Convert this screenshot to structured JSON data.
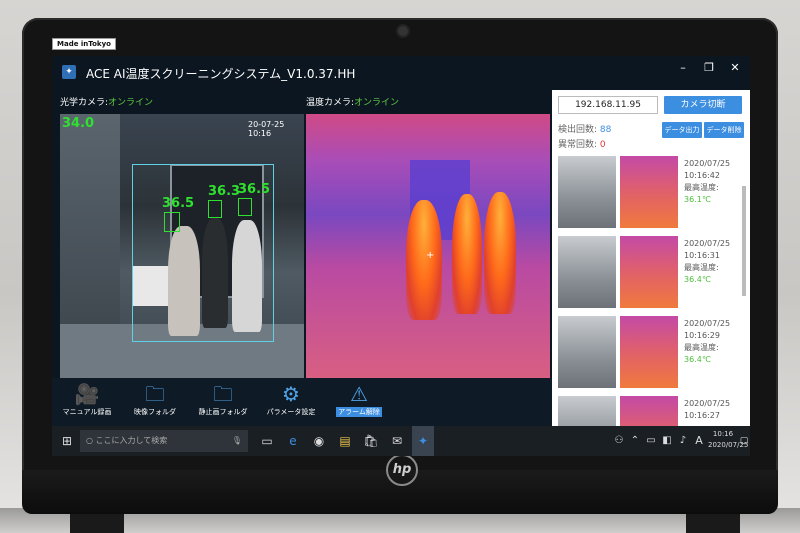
{
  "device": {
    "label": "Made inTokyo",
    "brand": "hp"
  },
  "app": {
    "title": "ACE AI温度スクリーニングシステム_V1.0.37.HH"
  },
  "optical_camera": {
    "label": "光学カメラ:",
    "status": "オンライン",
    "corner_temp": "34.0",
    "timestamp": "20-07-25 10:16",
    "face_temps": [
      "36.5",
      "36.3",
      "36.5"
    ]
  },
  "thermal_camera": {
    "label": "温度カメラ:",
    "status": "オンライン"
  },
  "panel": {
    "ip": "192.168.11.95",
    "camera_switch": "カメラ切断",
    "detect_label": "検出回数:",
    "detect_count": "88",
    "abnormal_label": "異常回数:",
    "abnormal_count": "0",
    "data_output": "データ出力",
    "data_delete": "データ削除",
    "entries": [
      {
        "date": "2020/07/25",
        "time": "10:16:42",
        "max_label": "最高温度:",
        "temp": "36.1℃"
      },
      {
        "date": "2020/07/25",
        "time": "10:16:31",
        "max_label": "最高温度:",
        "temp": "36.4℃"
      },
      {
        "date": "2020/07/25",
        "time": "10:16:29",
        "max_label": "最高温度:",
        "temp": "36.4℃"
      },
      {
        "date": "2020/07/25",
        "time": "10:16:27",
        "max_label": "",
        "temp": ""
      }
    ]
  },
  "toolbar": {
    "manual_record": "マニュアル録画",
    "video_folder": "映像フォルダ",
    "still_folder": "静止画フォルダ",
    "parameter_settings": "パラメータ設定",
    "alarm_release": "アラーム解除"
  },
  "taskbar": {
    "search_placeholder": "ここに入力して検索",
    "time": "10:16",
    "date": "2020/07/25",
    "ime": "A"
  },
  "colors": {
    "online": "#5fcf3f",
    "accent": "#3c8ee0",
    "face_box": "#2fe02f"
  }
}
